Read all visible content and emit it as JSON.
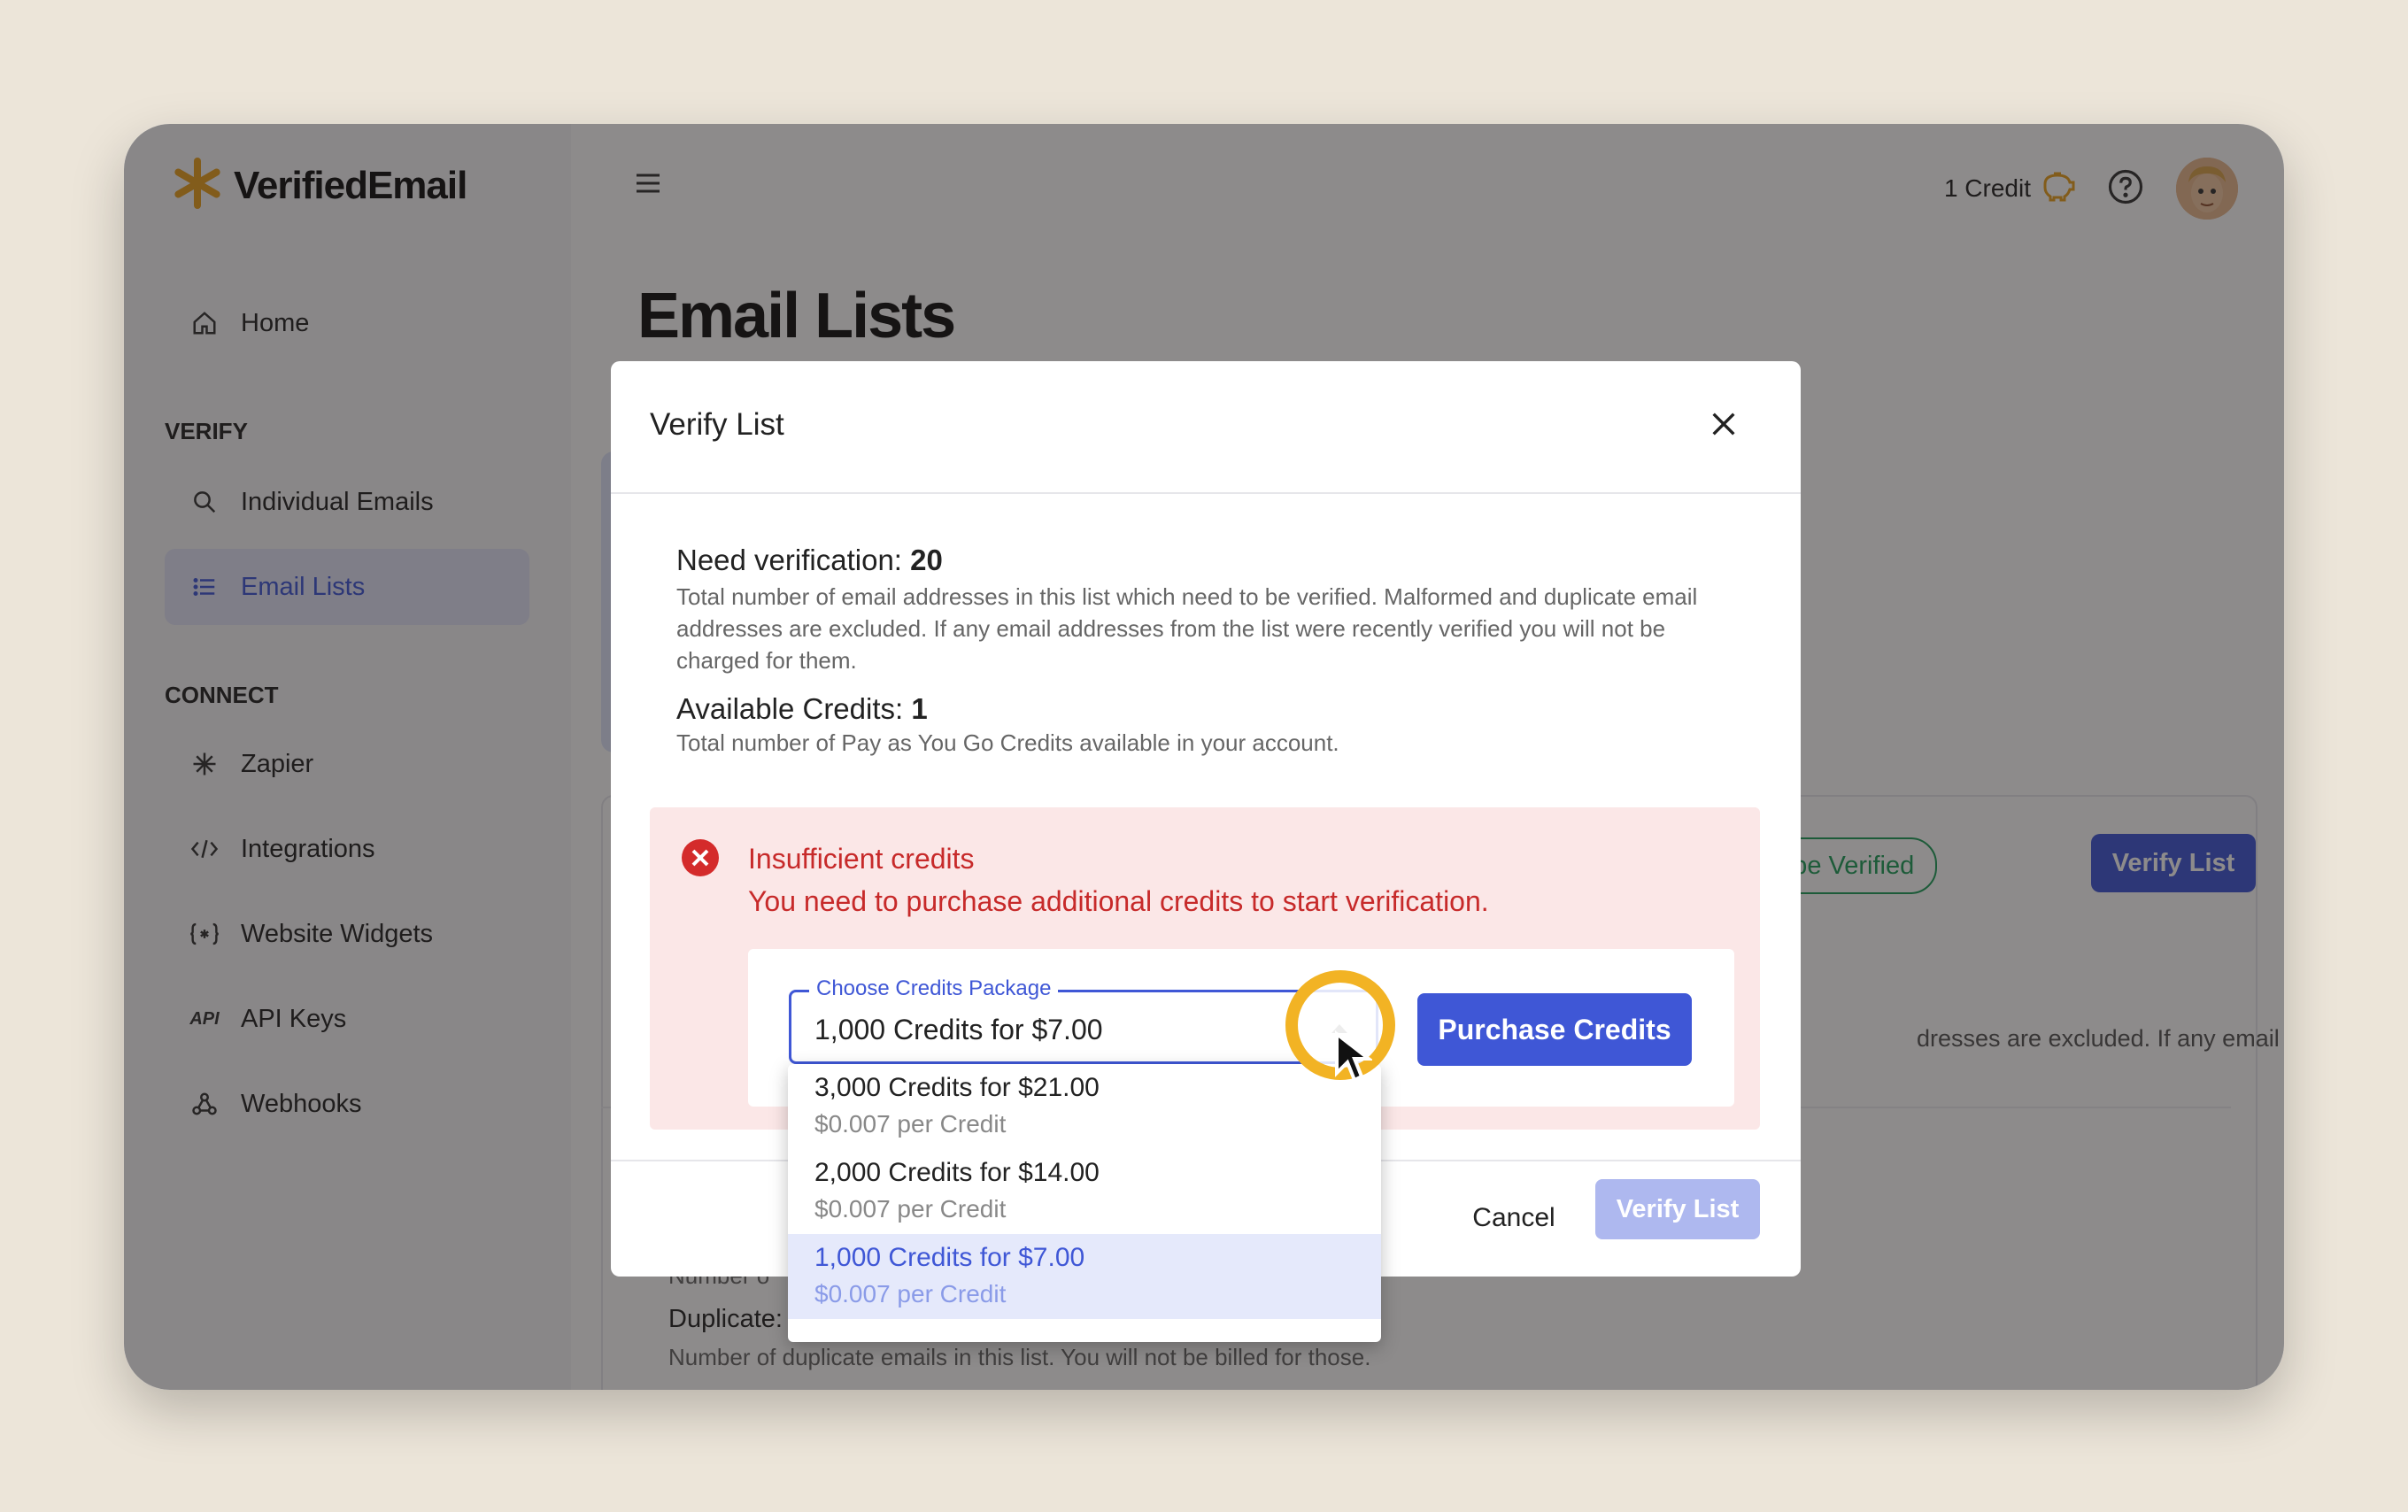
{
  "app": {
    "name": "VerifiedEmail"
  },
  "sidebar": {
    "sections": {
      "verify": "VERIFY",
      "connect": "CONNECT"
    },
    "items": [
      {
        "label": "Home",
        "icon": "home-icon"
      },
      {
        "label": "Individual Emails",
        "icon": "search-icon"
      },
      {
        "label": "Email Lists",
        "icon": "list-icon",
        "active": true
      },
      {
        "label": "Zapier",
        "icon": "zapier-icon"
      },
      {
        "label": "Integrations",
        "icon": "code-icon"
      },
      {
        "label": "Website Widgets",
        "icon": "widget-icon"
      },
      {
        "label": "API Keys",
        "icon": "api-icon",
        "icon_text": "API"
      },
      {
        "label": "Webhooks",
        "icon": "webhook-icon"
      }
    ]
  },
  "topbar": {
    "credits": "1 Credit",
    "credits_icon": "piggy-bank-icon",
    "help_icon": "help-icon"
  },
  "page": {
    "title": "Email Lists",
    "background": {
      "chip_to_be_verified": "o be Verified",
      "verify_list_button": "Verify List",
      "partial_desc": "dresses are excluded. If any email",
      "duplicate_label": "Duplicate:",
      "duplicate_desc": "Number of duplicate emails in this list. You will not be billed for those.",
      "number_desc": "Number o"
    }
  },
  "modal": {
    "title": "Verify List",
    "need_label": "Need verification:",
    "need_value": "20",
    "need_desc": "Total number of email addresses in this list which need to be verified. Malformed and duplicate email addresses are excluded. If any email addresses from the list were recently verified you will not be charged for them.",
    "avail_label": "Available Credits:",
    "avail_value": "1",
    "avail_desc": "Total number of Pay as You Go Credits available in your account.",
    "alert": {
      "title": "Insufficient credits",
      "message": "You need to purchase additional credits to start verification."
    },
    "select": {
      "legend": "Choose Credits Package",
      "value": "1,000 Credits for $7.00"
    },
    "purchase_button": "Purchase Credits",
    "cancel_button": "Cancel",
    "verify_button": "Verify List"
  },
  "dropdown": {
    "options": [
      {
        "label": "3,000 Credits for $21.00",
        "sub": "$0.007 per Credit"
      },
      {
        "label": "2,000 Credits for $14.00",
        "sub": "$0.007 per Credit"
      },
      {
        "label": "1,000 Credits for $7.00",
        "sub": "$0.007 per Credit",
        "selected": true
      }
    ]
  },
  "colors": {
    "accent": "#3f57d6",
    "error": "#c72a2a",
    "error_bg": "#fbe7e7",
    "cursor_ring": "#f2b324"
  }
}
